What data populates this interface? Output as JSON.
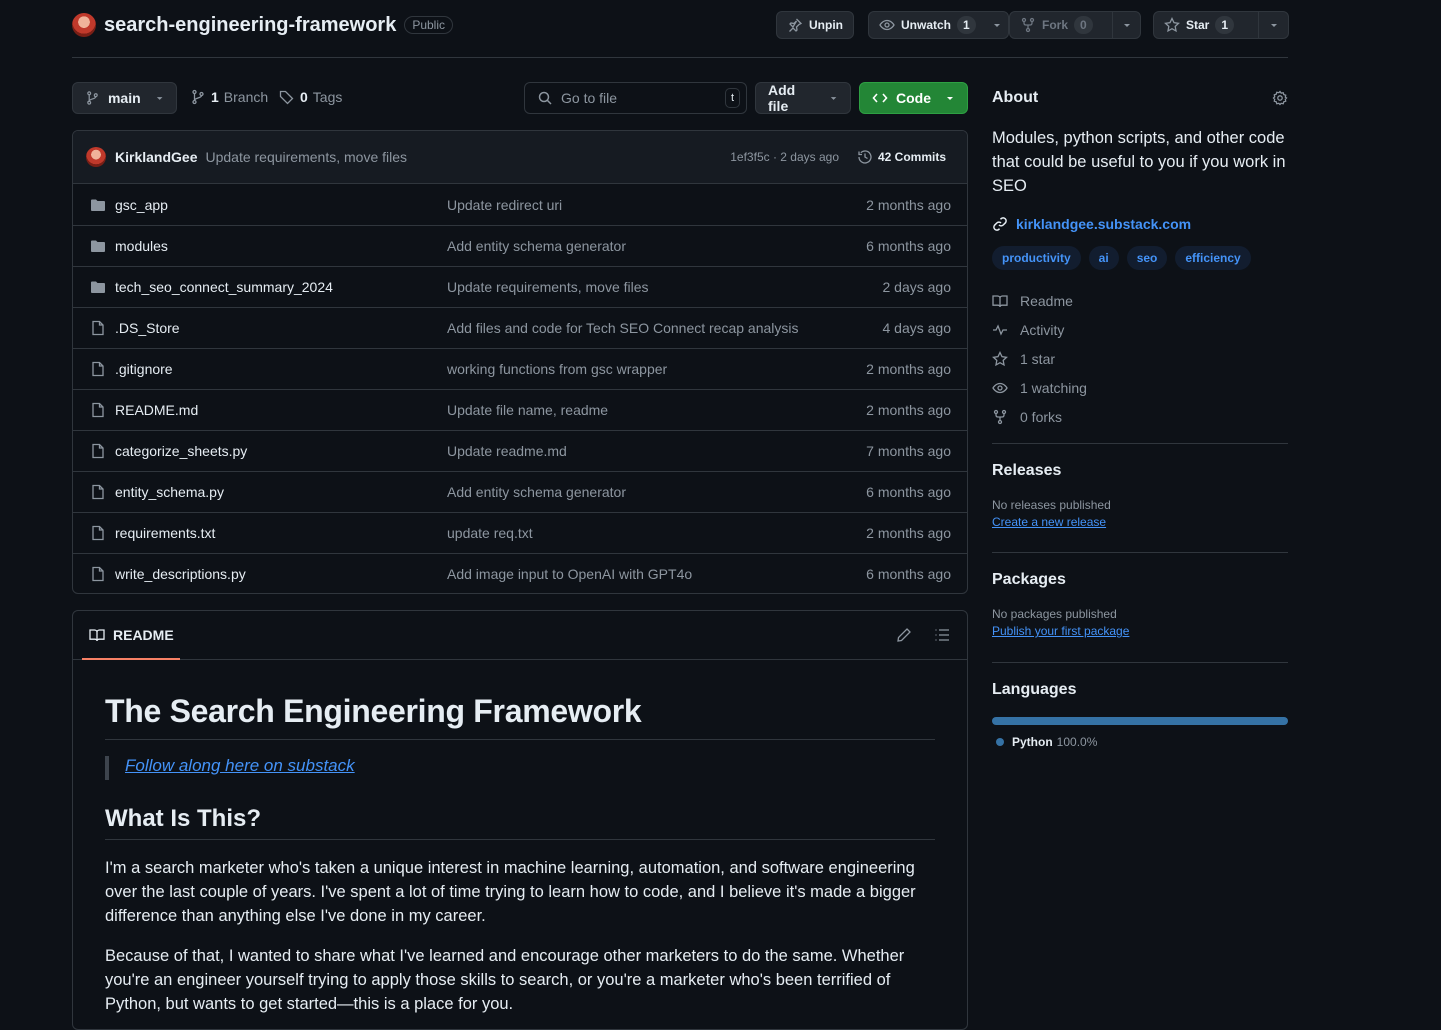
{
  "header": {
    "repo_name": "search-engineering-framework",
    "visibility": "Public",
    "unpin_label": "Unpin",
    "unwatch_label": "Unwatch",
    "watch_count": "1",
    "fork_label": "Fork",
    "fork_count": "0",
    "star_label": "Star",
    "star_count": "1"
  },
  "toolbar": {
    "branch": "main",
    "branch_count": "1",
    "branch_label": "Branch",
    "tag_count": "0",
    "tag_label": "Tags",
    "search_placeholder": "Go to file",
    "search_shortcut": "t",
    "add_file_label": "Add file",
    "code_label": "Code"
  },
  "latest_commit": {
    "author": "KirklandGee",
    "message": "Update requirements, move files",
    "meta": "1ef3f5c · 2 days ago",
    "commits_label": "42 Commits"
  },
  "files": [
    {
      "name": "gsc_app",
      "type": "dir",
      "message": "Update redirect uri",
      "date": "2 months ago"
    },
    {
      "name": "modules",
      "type": "dir",
      "message": "Add entity schema generator",
      "date": "6 months ago"
    },
    {
      "name": "tech_seo_connect_summary_2024",
      "type": "dir",
      "message": "Update requirements, move files",
      "date": "2 days ago"
    },
    {
      "name": ".DS_Store",
      "type": "file",
      "message": "Add files and code for Tech SEO Connect recap analysis",
      "date": "4 days ago"
    },
    {
      "name": ".gitignore",
      "type": "file",
      "message": "working functions from gsc wrapper",
      "date": "2 months ago"
    },
    {
      "name": "README.md",
      "type": "file",
      "message": "Update file name, readme",
      "date": "2 months ago"
    },
    {
      "name": "categorize_sheets.py",
      "type": "file",
      "message": "Update readme.md",
      "date": "7 months ago"
    },
    {
      "name": "entity_schema.py",
      "type": "file",
      "message": "Add entity schema generator",
      "date": "6 months ago"
    },
    {
      "name": "requirements.txt",
      "type": "file",
      "message": "update req.txt",
      "date": "2 months ago"
    },
    {
      "name": "write_descriptions.py",
      "type": "file",
      "message": "Add image input to OpenAI with GPT4o",
      "date": "6 months ago"
    }
  ],
  "readme": {
    "tab_label": "README",
    "title": "The Search Engineering Framework",
    "quote_link": "Follow along here on substack",
    "h2": "What Is This?",
    "p1": "I'm a search marketer who's taken a unique interest in machine learning, automation, and software engineering over the last couple of years. I've spent a lot of time trying to learn how to code, and I believe it's made a bigger difference than anything else I've done in my career.",
    "p2": "Because of that, I wanted to share what I've learned and encourage other marketers to do the same. Whether you're an engineer yourself trying to apply those skills to search, or you're a marketer who's been terrified of Python, but wants to get started—this is a place for you."
  },
  "about": {
    "heading": "About",
    "description": "Modules, python scripts, and other code that could be useful to you if you work in SEO",
    "website": "kirklandgee.substack.com",
    "topics": [
      "productivity",
      "ai",
      "seo",
      "efficiency"
    ],
    "readme": "Readme",
    "activity": "Activity",
    "stars": "1 star",
    "watching": "1 watching",
    "forks": "0 forks"
  },
  "releases": {
    "heading": "Releases",
    "empty": "No releases published",
    "create_link": "Create a new release"
  },
  "packages": {
    "heading": "Packages",
    "empty": "No packages published",
    "publish_link": "Publish your first package"
  },
  "languages": {
    "heading": "Languages",
    "items": [
      {
        "name": "Python",
        "percent": "100.0%",
        "fraction": 1.0,
        "color": "#3572A5"
      }
    ]
  },
  "colors": {
    "background": "#0d1117",
    "border": "#30363d",
    "link": "#4493f8",
    "code_button": "#238636"
  }
}
